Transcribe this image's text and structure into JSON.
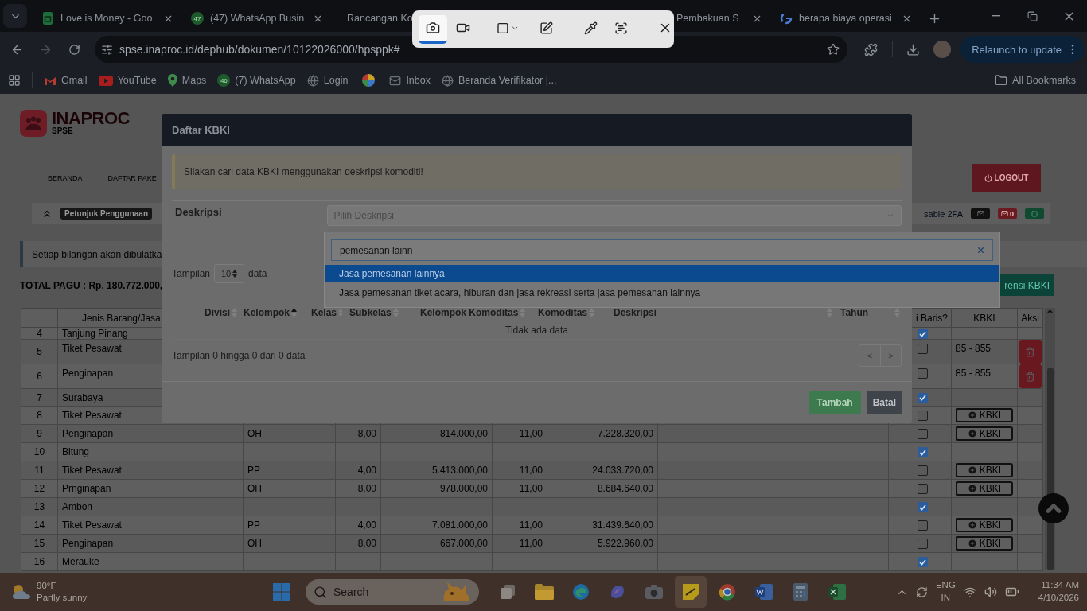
{
  "browser": {
    "tabs": [
      {
        "title": "Love is Money - Goo",
        "selected": false,
        "closable": true
      },
      {
        "badge": "47",
        "title": "(47) WhatsApp Busin",
        "selected": false,
        "closable": true
      },
      {
        "title": "Rancangan Ko",
        "selected": false
      },
      {
        "title": "Pembakuan S",
        "selected": false,
        "closable": true
      },
      {
        "title": "berapa biaya operasi",
        "selected": false,
        "closable": true
      }
    ],
    "url": "spse.inaproc.id/dephub/dokumen/10122026000/hpsppk#",
    "relaunch": "Relaunch to update",
    "bookmarks": [
      {
        "label": "Gmail"
      },
      {
        "label": "YouTube"
      },
      {
        "label": "Maps"
      },
      {
        "badge": "46",
        "label": "(7) WhatsApp"
      },
      {
        "label": "Login"
      },
      {
        "kind": "icon-only"
      },
      {
        "label": "Inbox"
      },
      {
        "label": "Beranda Verifikator |..."
      }
    ],
    "all_bookmarks": "All Bookmarks"
  },
  "snip_toolbar": {
    "modes": [
      {
        "kind": "photo",
        "selected": true
      },
      {
        "kind": "video",
        "selected": false
      }
    ]
  },
  "page": {
    "logo": "INAPROC",
    "logo_sub": "SPSE",
    "nav": [
      "BERANDA",
      "DAFTAR PAKE"
    ],
    "logout": "LOGOUT",
    "guide": "Petunjuk Penggunaan",
    "twofa": "sable 2FA",
    "message_count": "0",
    "notice": "Setiap bilangan akan dibulatka",
    "total": "TOTAL PAGU : Rp. 180.772.000,",
    "kbki_ref": "rensi KBKI",
    "table": {
      "headers": {
        "item": "Jenis Barang/Jasa",
        "column_9": "i Baris?",
        "kbki": "KBKI",
        "action": "Aksi"
      },
      "rows": [
        {
          "no": "4",
          "name": "Tanjung Pinang",
          "checked": true
        },
        {
          "no": "5",
          "name": "Tiket Pesawat",
          "checked": false,
          "kbki": {
            "kind": "code",
            "text": "85 - 855"
          },
          "deletable": true
        },
        {
          "no": "6",
          "name": "Penginapan",
          "checked": false,
          "kbki": {
            "kind": "code",
            "text": "85 - 855"
          },
          "deletable": true
        },
        {
          "no": "7",
          "name": "Surabaya",
          "checked": true
        },
        {
          "no": "8",
          "name": "Tiket Pesawat",
          "checked": false,
          "kbki": {
            "kind": "button",
            "text": "KBKI"
          }
        },
        {
          "no": "9",
          "name": "Penginapan",
          "group": "OH",
          "volume": "8,00",
          "price": "814.000,00",
          "tax": "11,00",
          "total": "7.228.320,00",
          "checked": false,
          "kbki": {
            "kind": "button",
            "text": "KBKI"
          }
        },
        {
          "no": "10",
          "name": "Bitung",
          "checked": true
        },
        {
          "no": "11",
          "name": "Tiket Pesawat",
          "group": "PP",
          "volume": "4,00",
          "price": "5.413.000,00",
          "tax": "11,00",
          "total": "24.033.720,00",
          "checked": false,
          "kbki": {
            "kind": "button",
            "text": "KBKI"
          }
        },
        {
          "no": "12",
          "name": "Prnginapan",
          "group": "OH",
          "volume": "8,00",
          "price": "978.000,00",
          "tax": "11,00",
          "total": "8.684.640,00",
          "checked": false,
          "kbki": {
            "kind": "button",
            "text": "KBKI"
          }
        },
        {
          "no": "13",
          "name": "Ambon",
          "checked": true
        },
        {
          "no": "14",
          "name": "Tiket Pesawat",
          "group": "PP",
          "volume": "4,00",
          "price": "7.081.000,00",
          "tax": "11,00",
          "total": "31.439.640,00",
          "checked": false,
          "kbki": {
            "kind": "button",
            "text": "KBKI"
          }
        },
        {
          "no": "15",
          "name": "Penginapan",
          "group": "OH",
          "volume": "8,00",
          "price": "667.000,00",
          "tax": "11,00",
          "total": "5.922.960,00",
          "checked": false,
          "kbki": {
            "kind": "button",
            "text": "KBKI"
          }
        },
        {
          "no": "16",
          "name": "Merauke",
          "checked": true
        }
      ]
    }
  },
  "modal": {
    "title": "Daftar KBKI",
    "alert": "Silakan cari data KBKI menggunakan deskripsi komoditi!",
    "field_label": "Deskripsi",
    "select_placeholder": "Pilih Deskripsi",
    "length_prefix": "Tampilan",
    "length_value": "10",
    "length_suffix": "data",
    "columns": [
      {
        "label": "Divisi",
        "sorted": false
      },
      {
        "label": "Kelompok",
        "sorted": true
      },
      {
        "label": "Kelas",
        "sorted": false
      },
      {
        "label": "Subkelas",
        "sorted": false
      },
      {
        "label": "Kelompok Komoditas",
        "sorted": false
      },
      {
        "label": "Komoditas",
        "sorted": false
      },
      {
        "label": "Deskripsi",
        "sorted": false
      },
      {
        "label": "Tahun",
        "sorted": false
      }
    ],
    "empty": "Tidak ada data",
    "info": "Tampilan 0 hingga 0 dari 0 data",
    "pager": [
      "<",
      ">"
    ],
    "buttons": [
      {
        "kind": "primary",
        "label": "Tambah"
      },
      {
        "kind": "secondary",
        "label": "Batal"
      }
    ]
  },
  "dropdown": {
    "search_value": "pemesanan lainn",
    "options": [
      {
        "label": "Jasa pemesanan lainnya",
        "selected": true
      },
      {
        "label": "Jasa pemesanan tiket acara, hiburan dan jasa rekreasi serta jasa pemesanan lainnya",
        "selected": false
      }
    ]
  },
  "taskbar": {
    "weather": {
      "temp": "90°F",
      "text": "Partly sunny"
    },
    "search": "Search",
    "apps": [
      {
        "kind": "task-view",
        "selected": false
      },
      {
        "kind": "files",
        "selected": false
      },
      {
        "kind": "edge",
        "selected": false
      },
      {
        "kind": "copilot",
        "selected": false
      },
      {
        "kind": "camera",
        "selected": false
      },
      {
        "kind": "notes",
        "selected": true
      },
      {
        "kind": "chrome",
        "selected": false
      },
      {
        "kind": "word",
        "selected": false
      },
      {
        "kind": "calculator",
        "selected": false
      },
      {
        "kind": "excel",
        "selected": false
      }
    ],
    "lang": [
      "ENG",
      "IN"
    ],
    "time": "11:34 AM",
    "date": "4/10/2026"
  }
}
